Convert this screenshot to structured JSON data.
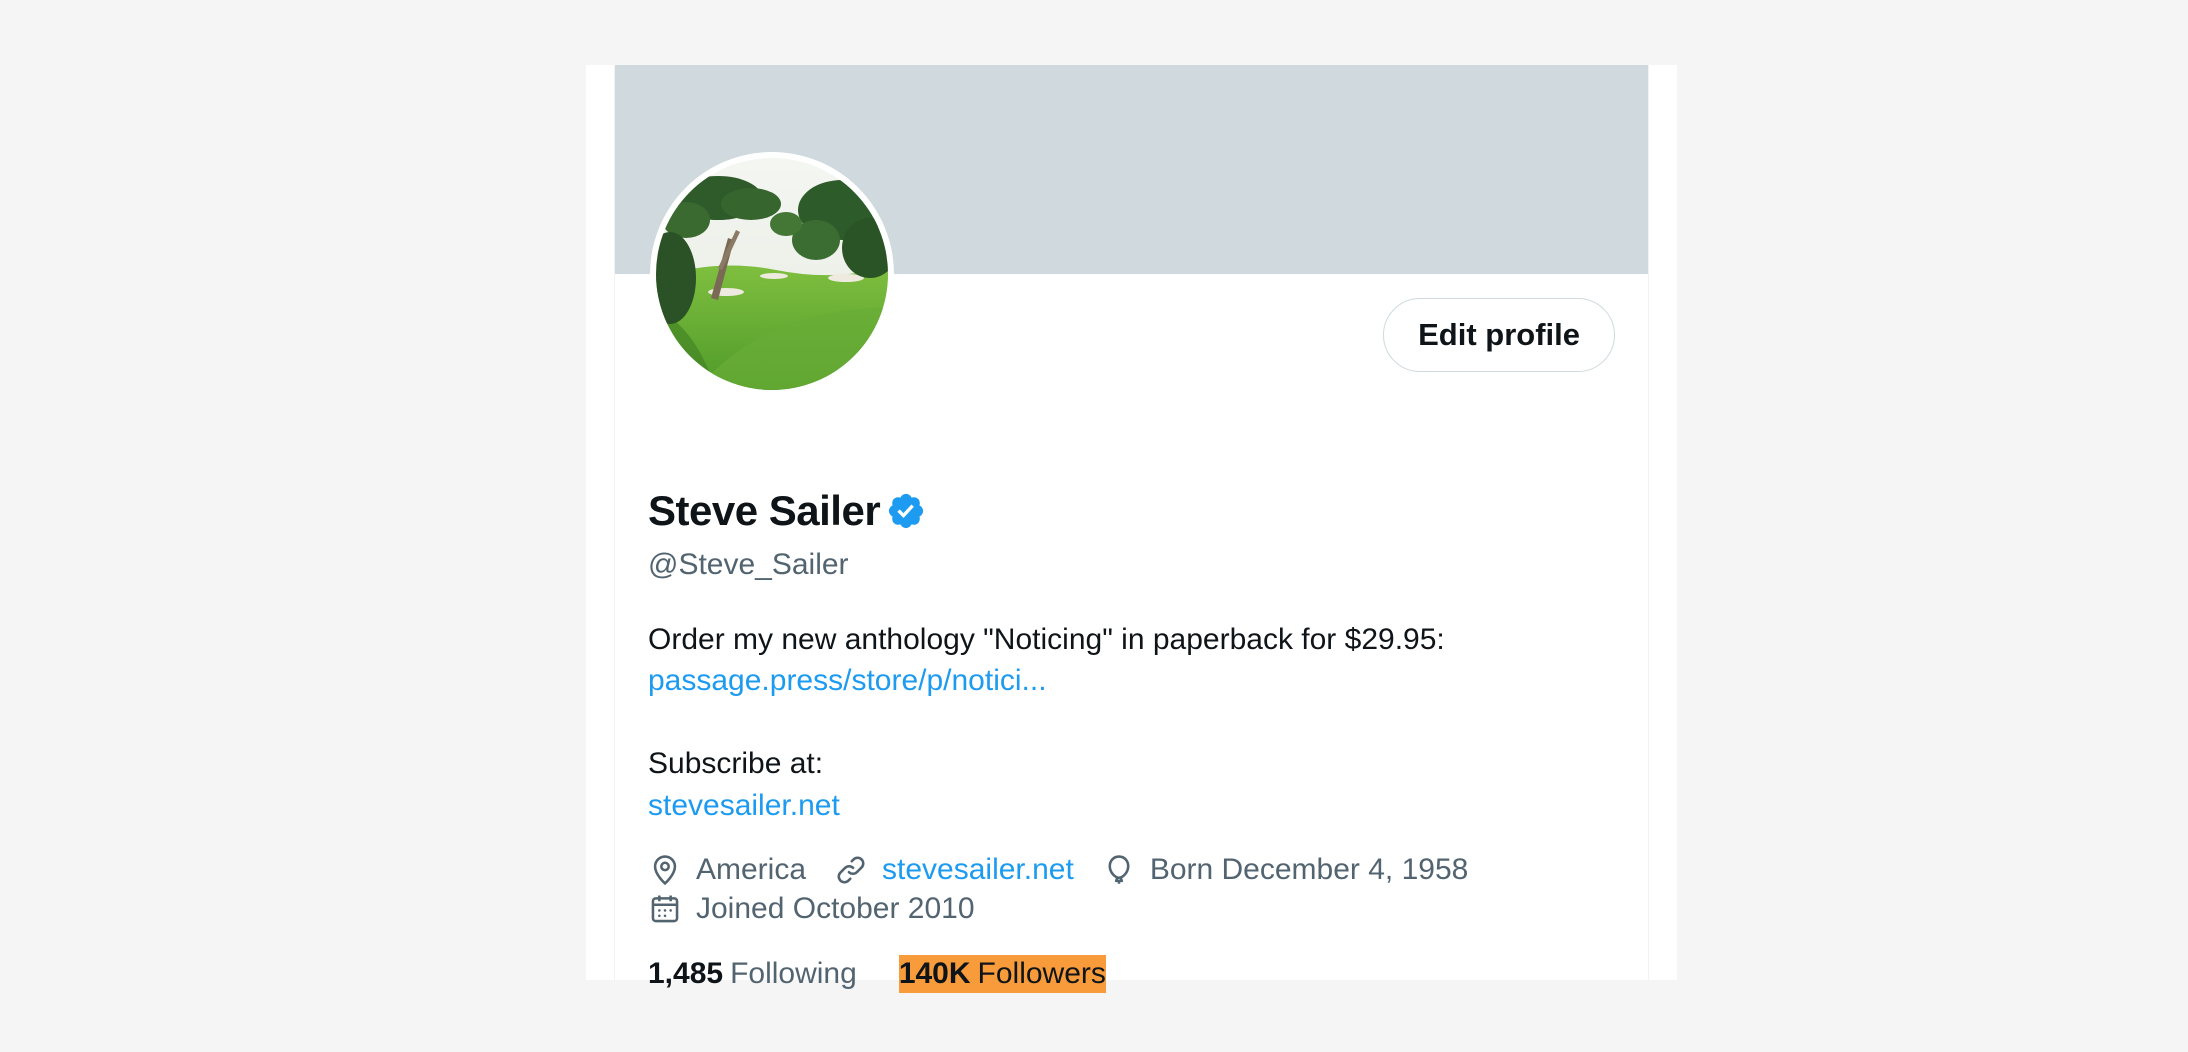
{
  "profile": {
    "display_name": "Steve Sailer",
    "verified": true,
    "handle": "@Steve_Sailer",
    "edit_button_label": "Edit profile",
    "bio": {
      "line1": "Order my new anthology \"Noticing\" in paperback for $29.95:",
      "link1": "passage.press/store/p/notici...",
      "line2": "Subscribe at:",
      "link2": "stevesailer.net"
    },
    "meta": {
      "location": "America",
      "website": "stevesailer.net",
      "birthday": "Born December 4, 1958",
      "joined": "Joined October 2010"
    },
    "stats": {
      "following_count": "1,485",
      "following_label": "Following",
      "followers_count": "140K",
      "followers_label": "Followers"
    }
  },
  "colors": {
    "page_background": "#f5f5f5",
    "banner": "#cfd9de",
    "link": "#1d9bf0",
    "verified_badge": "#1d9bf0",
    "secondary_text": "#536471",
    "followers_highlight": "#f89b3b"
  },
  "icons": {
    "location": "location-pin-icon",
    "website": "link-icon",
    "birthday": "balloon-icon",
    "joined": "calendar-icon",
    "verified": "verified-badge-icon"
  }
}
